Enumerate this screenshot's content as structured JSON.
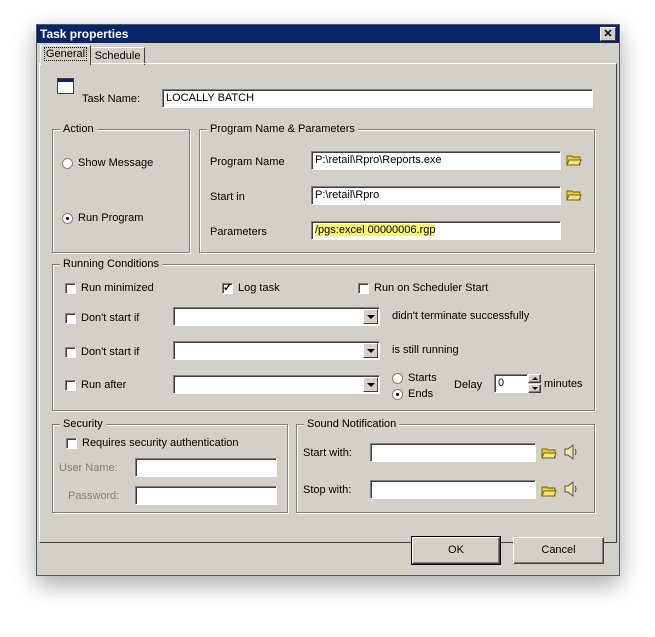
{
  "window": {
    "title": "Task properties",
    "close_glyph": "✕"
  },
  "tabs": [
    {
      "label": "General",
      "active": true
    },
    {
      "label": "Schedule",
      "active": false
    }
  ],
  "task_name": {
    "label": "Task Name:",
    "value": "LOCALLY BATCH"
  },
  "action": {
    "legend": "Action",
    "options": [
      {
        "label": "Show Message",
        "selected": false
      },
      {
        "label": "Run Program",
        "selected": true
      }
    ]
  },
  "program": {
    "legend": "Program Name & Parameters",
    "program_name": {
      "label": "Program Name",
      "value": "P:\\retail\\Rpro\\Reports.exe"
    },
    "start_in": {
      "label": "Start in",
      "value": "P:\\retail\\Rpro"
    },
    "parameters": {
      "label": "Parameters",
      "value": "/pgs:excel 00000006.rgp"
    },
    "folder_icon": "folder-open-icon",
    "highlight_color": "#f4f56a"
  },
  "conditions": {
    "legend": "Running Conditions",
    "run_minimized": {
      "label": "Run minimized",
      "checked": false
    },
    "log_task": {
      "label": "Log task",
      "checked": true
    },
    "run_on_scheduler_start": {
      "label": "Run on Scheduler Start",
      "checked": false
    },
    "dont_start_if_1": {
      "label": "Don't start if",
      "checked": false,
      "value": "",
      "suffix": "didn't terminate successfully"
    },
    "dont_start_if_2": {
      "label": "Don't start if",
      "checked": false,
      "value": "",
      "suffix": "is still running"
    },
    "run_after": {
      "label": "Run after",
      "checked": false,
      "value": ""
    },
    "starts": {
      "label": "Starts",
      "selected": false
    },
    "ends": {
      "label": "Ends",
      "selected": true
    },
    "delay": {
      "label": "Delay",
      "value": "0",
      "unit": "minutes"
    }
  },
  "security": {
    "legend": "Security",
    "requires_auth": {
      "label": "Requires security authentication",
      "checked": false
    },
    "user_name": {
      "label": "User Name:",
      "value": ""
    },
    "password": {
      "label": "Password:",
      "value": ""
    }
  },
  "sound": {
    "legend": "Sound Notification",
    "start_with": {
      "label": "Start with:",
      "value": ""
    },
    "stop_with": {
      "label": "Stop with:",
      "value": ""
    },
    "speaker_icon": "speaker-icon"
  },
  "buttons": {
    "ok": "OK",
    "cancel": "Cancel"
  }
}
